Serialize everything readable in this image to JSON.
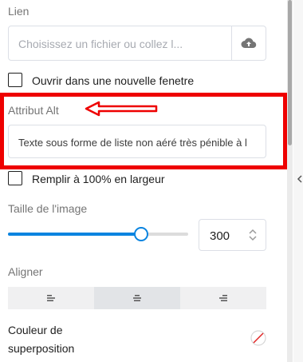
{
  "link": {
    "label": "Lien",
    "placeholder": "Choisissez un fichier ou collez l..."
  },
  "new_window": {
    "label": "Ouvrir dans une nouvelle fenetre",
    "checked": false
  },
  "alt": {
    "label": "Attribut Alt",
    "value": "Texte sous forme de liste non aéré très pénible à l"
  },
  "full_width": {
    "label": "Remplir à 100% en largeur",
    "checked": false
  },
  "image_size": {
    "label": "Taille de l'image",
    "value": "300",
    "slider_fraction": 0.74
  },
  "align": {
    "label": "Aligner",
    "options": [
      "left",
      "center",
      "right"
    ],
    "selected": "center"
  },
  "overlay": {
    "label_line1": "Couleur de",
    "label_line2": "superposition"
  },
  "colors": {
    "accent": "#0a84e0",
    "highlight_border": "#ee0000",
    "arrow": "#ee0000"
  },
  "icons": {
    "upload": "cloud-upload-icon",
    "spinner": "chevron-up-down-icon",
    "align_left": "align-left-icon",
    "align_center": "align-center-icon",
    "align_right": "align-right-icon",
    "no_color": "no-color-icon",
    "arrow": "red-arrow-left-icon"
  }
}
